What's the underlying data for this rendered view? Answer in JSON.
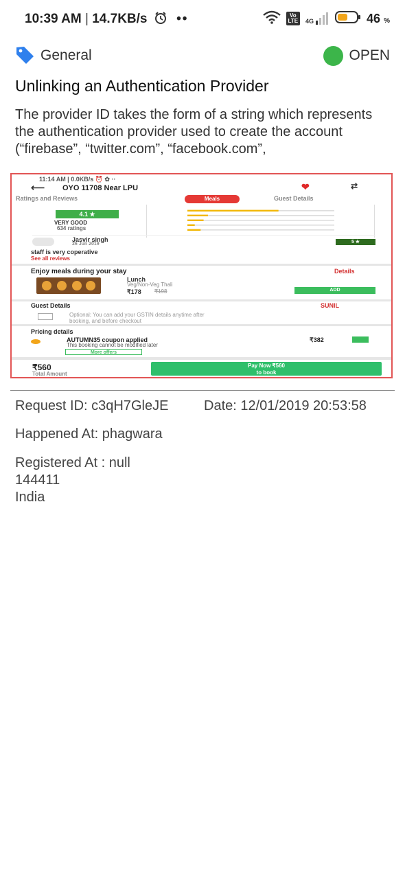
{
  "status_bar": {
    "time": "10:39 AM",
    "separator": " | ",
    "net_speed": "14.7KB/s",
    "dots": "••",
    "network_label": "4G",
    "volte_line1": "Vo",
    "volte_line2": "LTE",
    "battery_percent": "46",
    "battery_unit": "%",
    "icons": [
      "alarm-icon",
      "wifi-icon",
      "volte-icon",
      "signal-icon",
      "battery-icon"
    ]
  },
  "ticket": {
    "category": "General",
    "status": "OPEN",
    "status_color": "#3cb54a",
    "tag_color": "#2f80ed",
    "title": "Unlinking an Authentication Provider",
    "description": "The provider ID takes the form of a string which represents the authentication provider used to create the account (“firebase”, “twitter.com”, “facebook.com”,",
    "attachment": {
      "status": "11:14 AM | 0.0KB/s ⏰ ✿ ··",
      "hotel_title": "OYO 11708 Near LPU",
      "tabs": [
        "Ratings and Reviews",
        "Meals",
        "Guest Details"
      ],
      "rating": "4.1 ★",
      "rating_label": "VERY GOOD",
      "rating_count": "634 ratings",
      "rating_bars": [
        0.62,
        0.14,
        0.11,
        0.05,
        0.09
      ],
      "reviewer": "Jasvir singh",
      "review_date": "26 Jun 2019",
      "review_badge": "5 ★",
      "review_text": "staff is very coperative",
      "see_all": "See all reviews",
      "meals_heading": "Enjoy meals during your stay",
      "details_link": "Details",
      "meal_name": "Lunch",
      "meal_type": "Veg/Non-Veg Thali",
      "meal_price": "₹178",
      "meal_price_old": "₹198",
      "add_button": "ADD",
      "guest_heading": "Guest Details",
      "guest_name": "SUNIL",
      "gst_line1": "Optional: You can add your GSTIN details anytime after",
      "gst_line2": "booking, and before checkout",
      "pricing_heading": "Pricing details",
      "coupon": "AUTUMN35 coupon applied",
      "coupon_note": "This booking cannot be modified later",
      "discount": "₹382",
      "more_offers": "More offers",
      "total": "₹560",
      "total_label": "Total Amount",
      "pay_line1": "Pay Now ₹560",
      "pay_line2": "to book"
    }
  },
  "meta": {
    "request_id": "Request ID: c3qH7GleJE",
    "date": "Date: 12/01/2019 20:53:58",
    "happened_at": "Happened At: phagwara",
    "registered_at": "Registered At : null",
    "postal_code": "144411",
    "country": "India"
  }
}
